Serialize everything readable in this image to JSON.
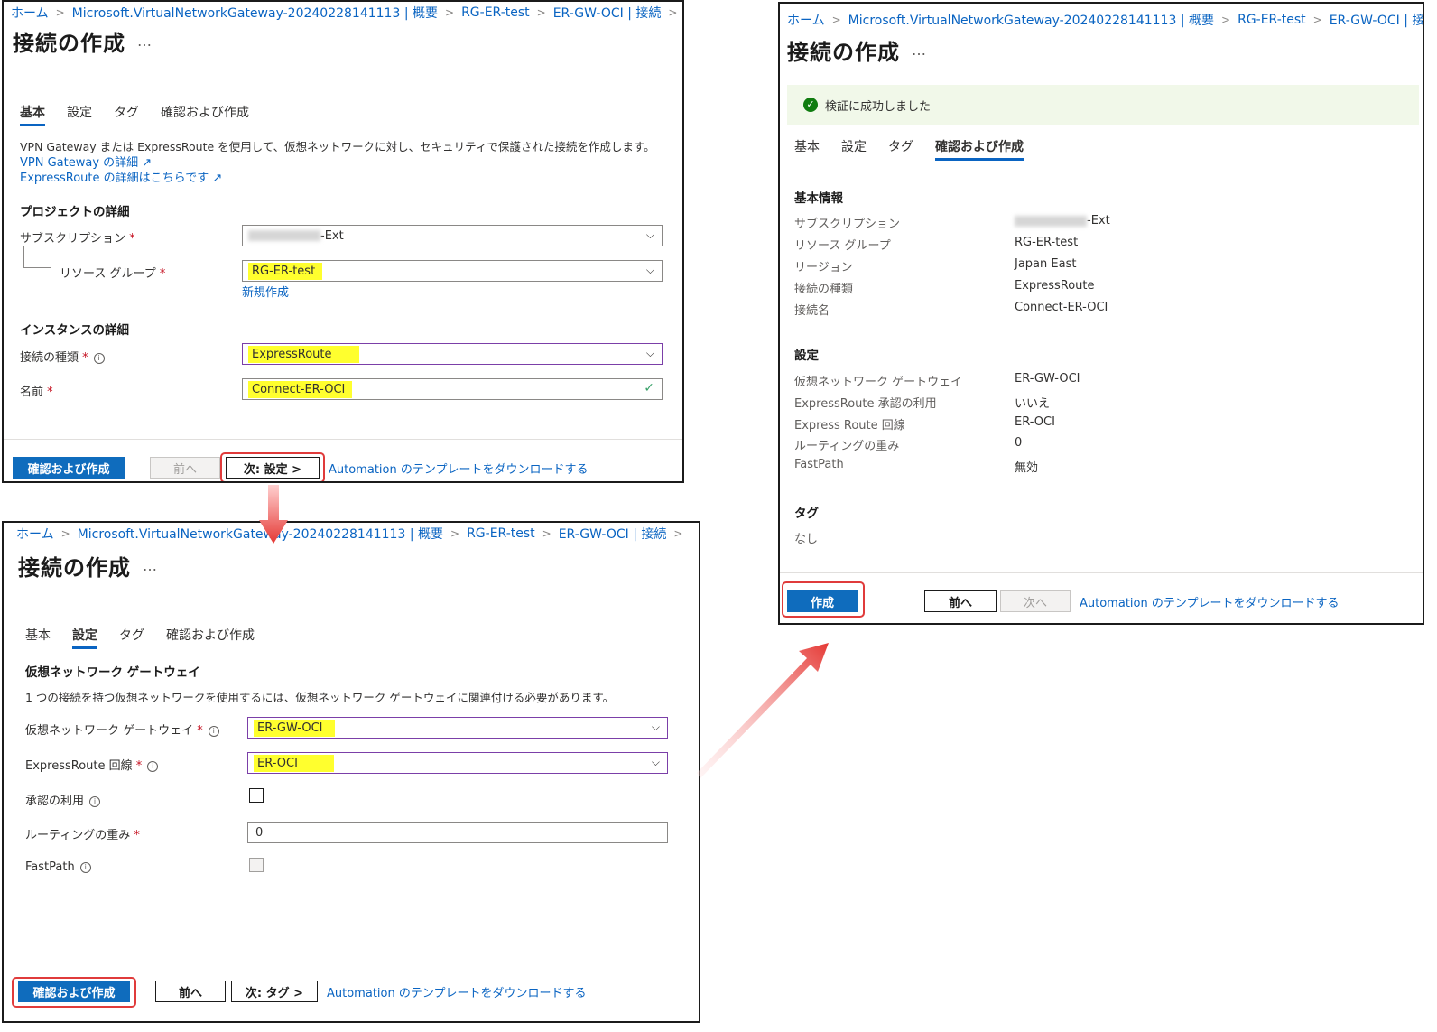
{
  "colors": {
    "accent": "#0f6cbd",
    "highlight": "#ffff2e",
    "arrow": "#e53935",
    "success": "#107c10"
  },
  "breadcrumb": [
    "ホーム",
    "Microsoft.VirtualNetworkGateway-20240228141113 | 概要",
    "RG-ER-test",
    "ER-GW-OCI | 接続"
  ],
  "page_title": "接続の作成",
  "more": "…",
  "tabs": [
    "基本",
    "設定",
    "タグ",
    "確認および作成"
  ],
  "automation_link": "Automation のテンプレートをダウンロードする",
  "panel_basic": {
    "description": "VPN Gateway または ExpressRoute を使用して、仮想ネットワークに対し、セキュリティで保護された接続を作成します。",
    "link_vpn": "VPN Gateway の詳細",
    "link_er": "ExpressRoute の詳細はこちらです",
    "section_project": "プロジェクトの詳細",
    "subscription_label": "サブスクリプション",
    "subscription_value": "-Ext",
    "rg_label": "リソース グループ",
    "rg_value": "RG-ER-test",
    "new_link": "新規作成",
    "section_instance": "インスタンスの詳細",
    "conn_type_label": "接続の種類",
    "conn_type_value": "ExpressRoute",
    "name_label": "名前",
    "name_value": "Connect-ER-OCI",
    "btn_review": "確認および作成",
    "btn_prev": "前へ",
    "btn_next": "次: 設定 >"
  },
  "panel_settings": {
    "section_vng": "仮想ネットワーク ゲートウェイ",
    "description": "1 つの接続を持つ仮想ネットワークを使用するには、仮想ネットワーク ゲートウェイに関連付ける必要があります。",
    "vng_label": "仮想ネットワーク ゲートウェイ",
    "vng_value": "ER-GW-OCI",
    "circuit_label": "ExpressRoute 回線",
    "circuit_value": "ER-OCI",
    "auth_label": "承認の利用",
    "weight_label": "ルーティングの重み",
    "weight_value": "0",
    "fastpath_label": "FastPath",
    "btn_review": "確認および作成",
    "btn_prev": "前へ",
    "btn_next": "次: タグ >"
  },
  "panel_review": {
    "validation": "検証に成功しました",
    "section_basic": "基本情報",
    "basic_rows": [
      {
        "label": "サブスクリプション",
        "value": "-Ext"
      },
      {
        "label": "リソース グループ",
        "value": "RG-ER-test"
      },
      {
        "label": "リージョン",
        "value": "Japan East"
      },
      {
        "label": "接続の種類",
        "value": "ExpressRoute"
      },
      {
        "label": "接続名",
        "value": "Connect-ER-OCI"
      }
    ],
    "section_settings": "設定",
    "settings_rows": [
      {
        "label": "仮想ネットワーク ゲートウェイ",
        "value": "ER-GW-OCI"
      },
      {
        "label": "ExpressRoute 承認の利用",
        "value": "いいえ"
      },
      {
        "label": "Express Route 回線",
        "value": "ER-OCI"
      },
      {
        "label": "ルーティングの重み",
        "value": "0"
      },
      {
        "label": "FastPath",
        "value": "無効"
      }
    ],
    "section_tags": "タグ",
    "tags_value": "なし",
    "btn_create": "作成",
    "btn_prev": "前へ",
    "btn_next": "次へ"
  }
}
